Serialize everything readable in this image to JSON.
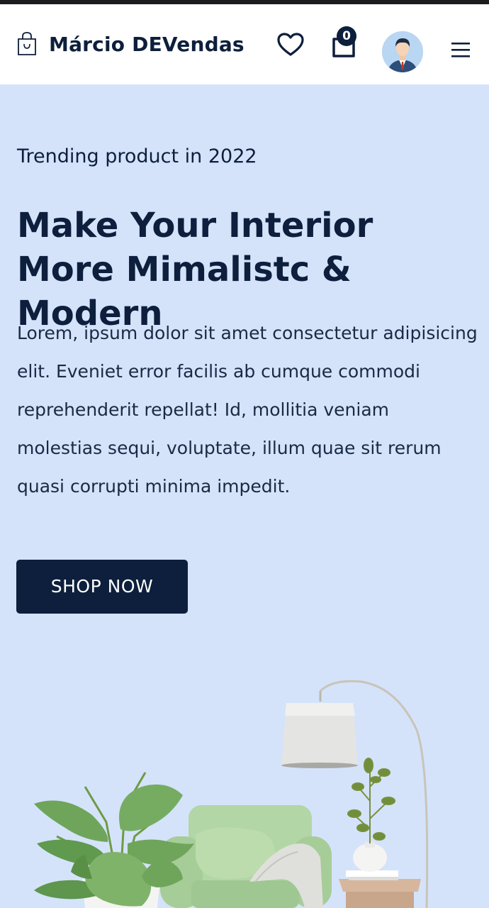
{
  "header": {
    "brand_name": "Márcio DEVendas",
    "cart_count": "0"
  },
  "hero": {
    "eyebrow": "Trending product in 2022",
    "headline": "Make Your Interior More Mimalistc & Modern",
    "description": "Lorem, ipsum dolor sit amet consectetur adipisicing elit. Eveniet error facilis ab cumque commodi reprehenderit repellat! Id, mollitia veniam molestias sequi, voluptate, illum quae sit rerum quasi corrupti minima impedit.",
    "cta_label": "SHOP NOW"
  },
  "icons": {
    "brand": "shopping-bag-icon",
    "wishlist": "heart-icon",
    "cart": "cart-icon",
    "profile": "avatar",
    "menu": "hamburger-menu-icon"
  },
  "colors": {
    "navy": "#0d1f3c",
    "hero_background": "#d4e3fa",
    "header_background": "#ffffff",
    "chair_green": "#a9cf9a"
  }
}
